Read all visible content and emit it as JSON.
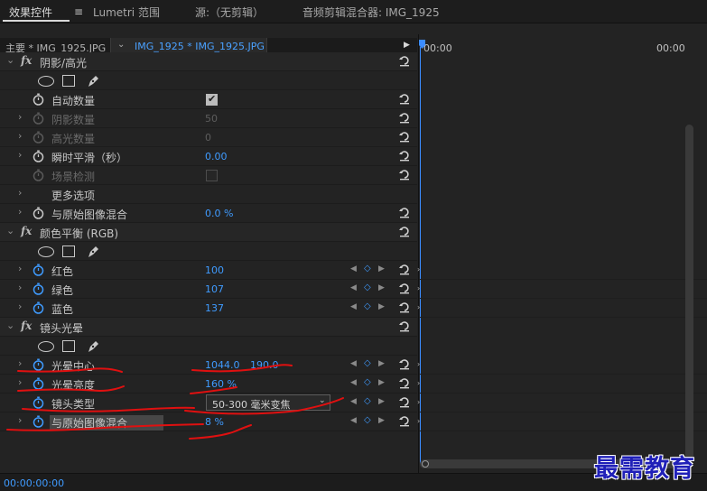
{
  "tabs": [
    {
      "label": "效果控件",
      "active": true
    },
    {
      "label": "Lumetri 范围",
      "active": false
    },
    {
      "label": "源:（无剪辑）",
      "active": false
    },
    {
      "label": "音频剪辑混合器: IMG_1925",
      "active": false
    }
  ],
  "tab_menu_icon": "≡",
  "source_bar": {
    "master_label": "主要 * IMG_1925.JPG",
    "clip_label": "IMG_1925 * IMG_1925.JPG",
    "play_icon": "▶"
  },
  "timeline": {
    "start_tc": "00:00",
    "end_tc": "00:00"
  },
  "effects": {
    "shadow_highlight": {
      "title": "阴影/高光",
      "auto_amount": "自动数量",
      "shadow_amount": "阴影数量",
      "shadow_amount_value": "50",
      "highlight_amount": "高光数量",
      "highlight_amount_value": "0",
      "temporal_smoothing": "瞬时平滑（秒）",
      "temporal_smoothing_value": "0.00",
      "scene_detect": "场景检测",
      "more_options": "更多选项",
      "blend": "与原始图像混合",
      "blend_value": "0.0 %"
    },
    "color_balance": {
      "title": "颜色平衡 (RGB)",
      "red": "红色",
      "red_value": "100",
      "green": "绿色",
      "green_value": "107",
      "blue": "蓝色",
      "blue_value": "137"
    },
    "lens_flare": {
      "title": "镜头光晕",
      "flare_center": "光晕中心",
      "flare_center_x": "1044.0",
      "flare_center_y": "190.0",
      "flare_brightness": "光晕亮度",
      "flare_brightness_value": "160 %",
      "lens_type": "镜头类型",
      "lens_type_value": "50-300 毫米变焦",
      "blend": "与原始图像混合",
      "blend_value": "8 %"
    }
  },
  "footer": {
    "timecode": "00:00:00:00"
  },
  "watermark": "最需教育",
  "colors": {
    "accent_blue": "#3f9bff",
    "annotation_red": "#e01010",
    "watermark_blue": "#2020b8"
  }
}
